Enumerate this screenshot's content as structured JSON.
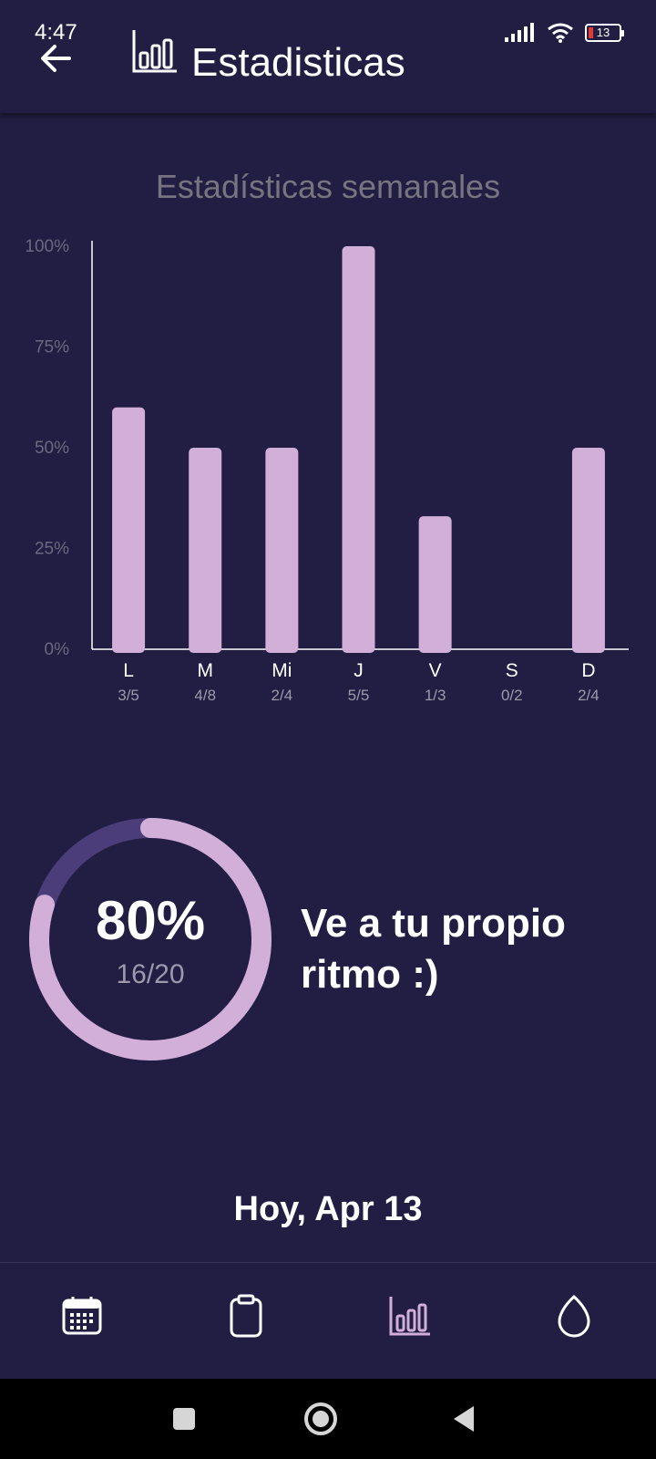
{
  "status_bar": {
    "time": "4:47",
    "battery": "13",
    "icons": [
      "signal-icon",
      "wifi-icon",
      "battery-icon"
    ]
  },
  "app_bar": {
    "title": "Estadisticas",
    "back_icon": "arrow-left-icon",
    "title_icon": "bar-chart-icon"
  },
  "chart_data": {
    "type": "bar",
    "title": "Estadísticas semanales",
    "categories": [
      "L",
      "M",
      "Mi",
      "J",
      "V",
      "S",
      "D"
    ],
    "sublabels": [
      "3/5",
      "4/8",
      "2/4",
      "5/5",
      "1/3",
      "0/2",
      "2/4"
    ],
    "values": [
      60,
      50,
      50,
      100,
      33,
      0,
      50
    ],
    "y_ticks": [
      "0%",
      "25%",
      "50%",
      "75%",
      "100%"
    ],
    "ylim": [
      0,
      100
    ],
    "grid": false,
    "bar_color": "#d1afd9",
    "xlabel": "",
    "ylabel": ""
  },
  "progress": {
    "percent_label": "80%",
    "fraction": "16/20",
    "value": 0.8,
    "ring_color": "#d1afd9",
    "track_color": "#4a3d7a"
  },
  "motivation_text": "Ve a tu propio ritmo :)",
  "today_label": "Hoy, Apr 13",
  "bottom_nav": [
    {
      "icon": "calendar-icon",
      "active": false
    },
    {
      "icon": "clipboard-icon",
      "active": false
    },
    {
      "icon": "bar-chart-icon",
      "active": true
    },
    {
      "icon": "drop-icon",
      "active": false
    }
  ],
  "colors": {
    "background": "#221d42",
    "accent": "#d1afd9",
    "muted_text": "#77747f"
  }
}
